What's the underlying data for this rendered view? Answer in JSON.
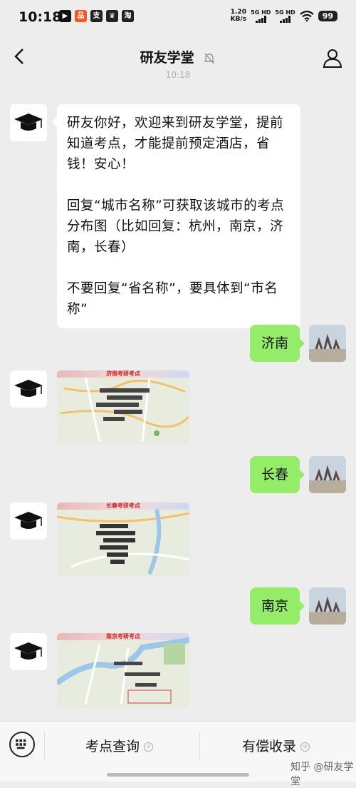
{
  "status_bar": {
    "time": "10:18",
    "net_speed_value": "1.20",
    "net_speed_unit": "KB/s",
    "sig1": "5G HD",
    "sig2": "5G HD",
    "battery": "99"
  },
  "header": {
    "title": "研友学堂"
  },
  "timestamp": "10:18",
  "messages": {
    "welcome": {
      "p1": "研友你好，欢迎来到研友学堂，提前知道考点，才能提前预定酒店，省钱！安心！",
      "p2": "回复“城市名称”可获取该城市的考点分布图（比如回复：杭州，南京，济南，长春）",
      "p3": "不要回复“省名称”，要具体到“市名称”"
    },
    "reply1": "济南",
    "map1_title": "济南考研考点",
    "reply2": "长春",
    "map2_title": "长春考研考点",
    "reply3": "南京",
    "map3_title": "南京考研考点"
  },
  "bottom_menu": {
    "item1": "考点查询",
    "item2": "有偿收录"
  },
  "watermark": "知乎 @研友学堂"
}
